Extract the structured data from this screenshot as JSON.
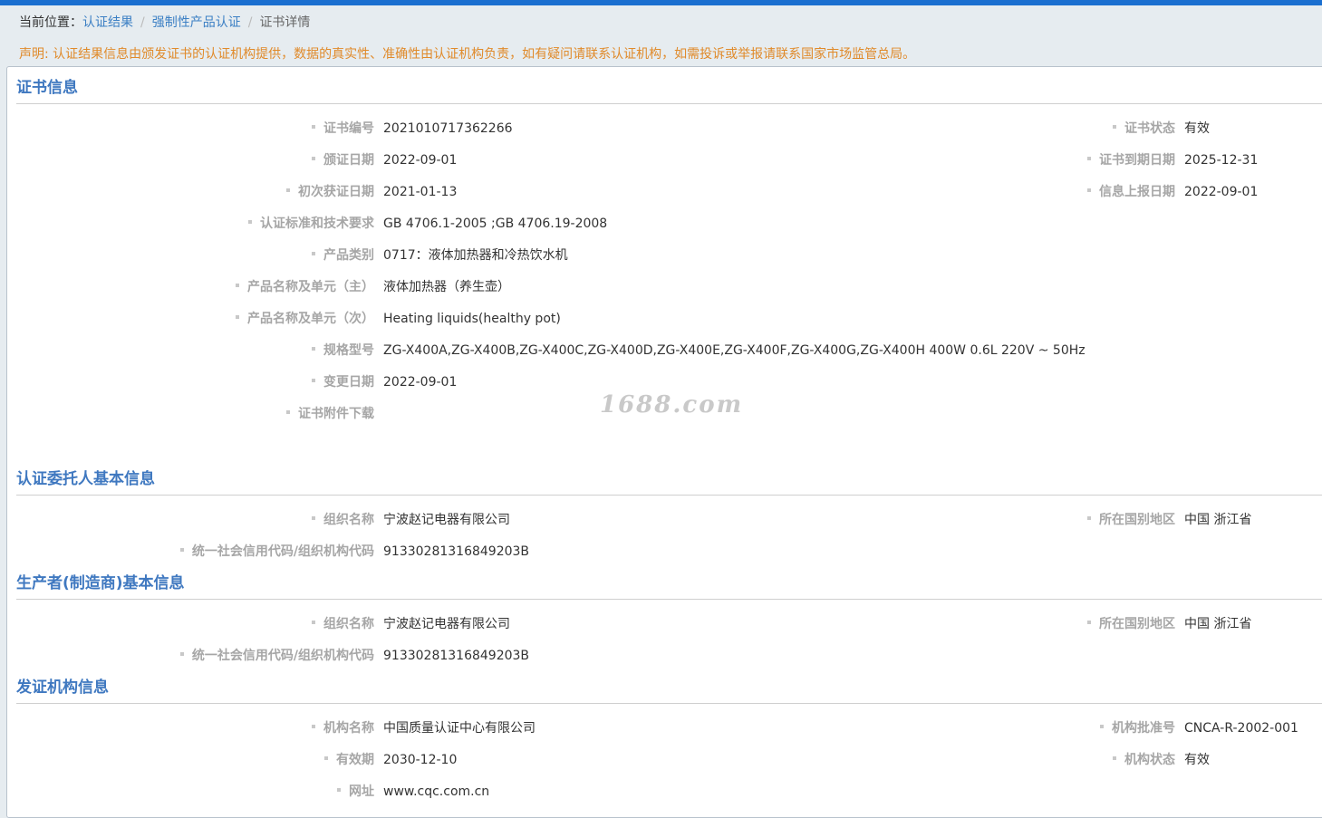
{
  "breadcrumb": {
    "lead": "当前位置：",
    "items": [
      "认证结果",
      "强制性产品认证"
    ],
    "current": "证书详情"
  },
  "notice": "声明: 认证结果信息由颁发证书的认证机构提供，数据的真实性、准确性由认证机构负责，如有疑问请联系认证机构，如需投诉或举报请联系国家市场监管总局。",
  "watermark": "1688.com",
  "cert": {
    "title": "证书信息",
    "left": [
      {
        "label": "证书编号",
        "value": "2021010717362266"
      },
      {
        "label": "颁证日期",
        "value": "2022-09-01"
      },
      {
        "label": "初次获证日期",
        "value": "2021-01-13"
      },
      {
        "label": "认证标准和技术要求",
        "value": "GB 4706.1-2005 ;GB 4706.19-2008"
      },
      {
        "label": "产品类别",
        "value": "0717：液体加热器和冷热饮水机"
      },
      {
        "label": "产品名称及单元（主）",
        "value": "液体加热器（养生壶）"
      },
      {
        "label": "产品名称及单元（次）",
        "value": "Heating liquids(healthy pot)"
      },
      {
        "label": "规格型号",
        "value": "ZG-X400A,ZG-X400B,ZG-X400C,ZG-X400D,ZG-X400E,ZG-X400F,ZG-X400G,ZG-X400H 400W 0.6L 220V ~ 50Hz"
      },
      {
        "label": "变更日期",
        "value": "2022-09-01"
      },
      {
        "label": "证书附件下载",
        "value": ""
      }
    ],
    "right": [
      {
        "label": "证书状态",
        "value": "有效"
      },
      {
        "label": "证书到期日期",
        "value": "2025-12-31"
      },
      {
        "label": "信息上报日期",
        "value": "2022-09-01"
      }
    ]
  },
  "applicant": {
    "title": "认证委托人基本信息",
    "left": [
      {
        "label": "组织名称",
        "value": "宁波赵记电器有限公司"
      },
      {
        "label": "统一社会信用代码/组织机构代码",
        "value": "91330281316849203B"
      }
    ],
    "right": [
      {
        "label": "所在国别地区",
        "value": "中国 浙江省"
      }
    ]
  },
  "manufacturer": {
    "title": "生产者(制造商)基本信息",
    "left": [
      {
        "label": "组织名称",
        "value": "宁波赵记电器有限公司"
      },
      {
        "label": "统一社会信用代码/组织机构代码",
        "value": "91330281316849203B"
      }
    ],
    "right": [
      {
        "label": "所在国别地区",
        "value": "中国 浙江省"
      }
    ]
  },
  "issuer": {
    "title": "发证机构信息",
    "left": [
      {
        "label": "机构名称",
        "value": "中国质量认证中心有限公司"
      },
      {
        "label": "有效期",
        "value": "2030-12-10"
      },
      {
        "label": "网址",
        "value": "www.cqc.com.cn"
      }
    ],
    "right": [
      {
        "label": "机构批准号",
        "value": "CNCA-R-2002-001"
      },
      {
        "label": "机构状态",
        "value": "有效"
      }
    ]
  }
}
